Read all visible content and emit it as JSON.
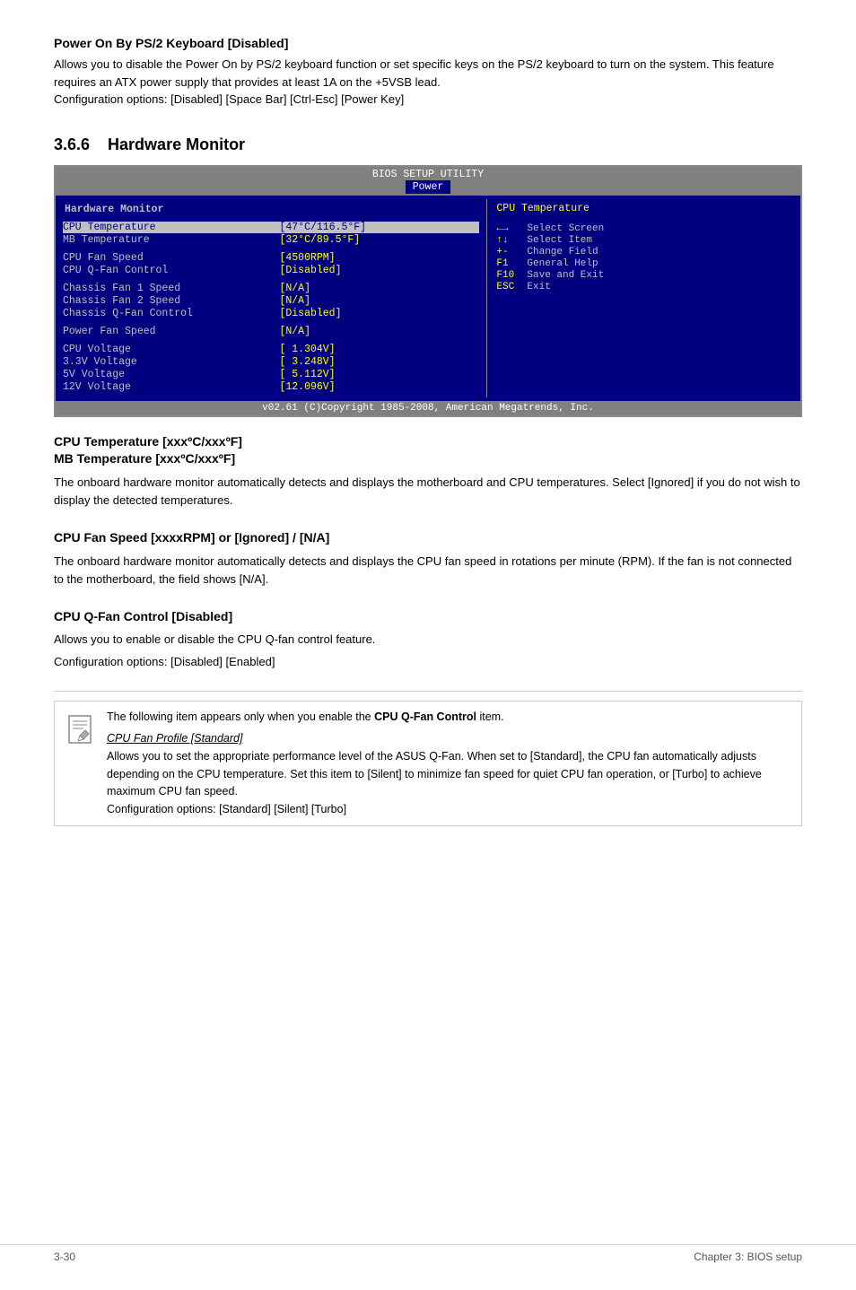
{
  "top_section": {
    "title": "Power On By PS/2 Keyboard [Disabled]",
    "body": "Allows you to disable the Power On by PS/2 keyboard function or set specific keys on the PS/2 keyboard to turn on the system. This feature requires an ATX power supply that provides at least 1A on the +5VSB lead.",
    "config_options": "Configuration options: [Disabled] [Space Bar] [Ctrl-Esc] [Power Key]"
  },
  "hw_section": {
    "number": "3.6.6",
    "title": "Hardware Monitor"
  },
  "bios": {
    "header_title": "BIOS SETUP UTILITY",
    "active_tab": "Power",
    "section_label": "Hardware Monitor",
    "rows": [
      {
        "label": "CPU Temperature",
        "value": "[47°C/116.5°F]",
        "selected": true
      },
      {
        "label": "MB Temperature",
        "value": "[32°C/89.5°F]",
        "selected": false
      },
      {
        "label": "",
        "value": "",
        "spacer": true
      },
      {
        "label": "CPU Fan Speed",
        "value": "[4500RPM]",
        "selected": false
      },
      {
        "label": "CPU Q-Fan Control",
        "value": "[Disabled]",
        "selected": false
      },
      {
        "label": "",
        "value": "",
        "spacer": true
      },
      {
        "label": "Chassis Fan 1 Speed",
        "value": "[N/A]",
        "selected": false
      },
      {
        "label": "Chassis Fan 2 Speed",
        "value": "[N/A]",
        "selected": false
      },
      {
        "label": "Chassis Q-Fan Control",
        "value": "[Disabled]",
        "selected": false
      },
      {
        "label": "",
        "value": "",
        "spacer": true
      },
      {
        "label": "Power Fan Speed",
        "value": "[N/A]",
        "selected": false
      },
      {
        "label": "",
        "value": "",
        "spacer": true
      },
      {
        "label": "CPU   Voltage",
        "value": "[ 1.304V]",
        "selected": false
      },
      {
        "label": "3.3V  Voltage",
        "value": "[ 3.248V]",
        "selected": false
      },
      {
        "label": "5V    Voltage",
        "value": "[ 5.112V]",
        "selected": false
      },
      {
        "label": "12V   Voltage",
        "value": "[12.096V]",
        "selected": false
      }
    ],
    "right_title": "CPU Temperature",
    "help_items": [
      {
        "key": "←→",
        "desc": "Select Screen"
      },
      {
        "key": "↑↓",
        "desc": "Select Item"
      },
      {
        "key": "+-",
        "desc": "Change Field"
      },
      {
        "key": "F1",
        "desc": "General Help"
      },
      {
        "key": "F10",
        "desc": "Save and Exit"
      },
      {
        "key": "ESC",
        "desc": "Exit"
      }
    ],
    "footer": "v02.61 (C)Copyright 1985-2008, American Megatrends, Inc."
  },
  "sections": [
    {
      "id": "cpu-temp",
      "title": "CPU Temperature [xxxºC/xxxºF]\nMB Temperature [xxxºC/xxxºF]",
      "body": "The onboard hardware monitor automatically detects and displays the motherboard and CPU temperatures. Select [Ignored] if you do not wish to display the detected temperatures.",
      "config": null
    },
    {
      "id": "cpu-fan-speed",
      "title": "CPU Fan Speed [xxxxRPM] or [Ignored] / [N/A]",
      "body": "The onboard hardware monitor automatically detects and displays the CPU fan speed in rotations per minute (RPM). If the fan is not connected to the motherboard, the field shows [N/A].",
      "config": null
    },
    {
      "id": "cpu-qfan",
      "title": "CPU Q-Fan Control [Disabled]",
      "body": "Allows you to enable or disable the CPU Q-fan control feature.",
      "config": "Configuration options: [Disabled] [Enabled]"
    }
  ],
  "note": {
    "text_prefix": "The following item appears only when you enable the ",
    "text_bold": "CPU Q-Fan Control",
    "text_suffix": " item.",
    "subitem_title": "CPU Fan Profile [Standard]",
    "subitem_body": "Allows you to set the appropriate performance level of the ASUS Q-Fan. When set to [Standard], the CPU fan automatically adjusts depending on the CPU temperature. Set this item to [Silent] to minimize fan speed for quiet CPU fan operation, or [Turbo] to achieve maximum CPU fan speed.",
    "subitem_config": "Configuration options: [Standard] [Silent] [Turbo]"
  },
  "page_footer": {
    "left": "3-30",
    "right": "Chapter 3: BIOS setup"
  }
}
